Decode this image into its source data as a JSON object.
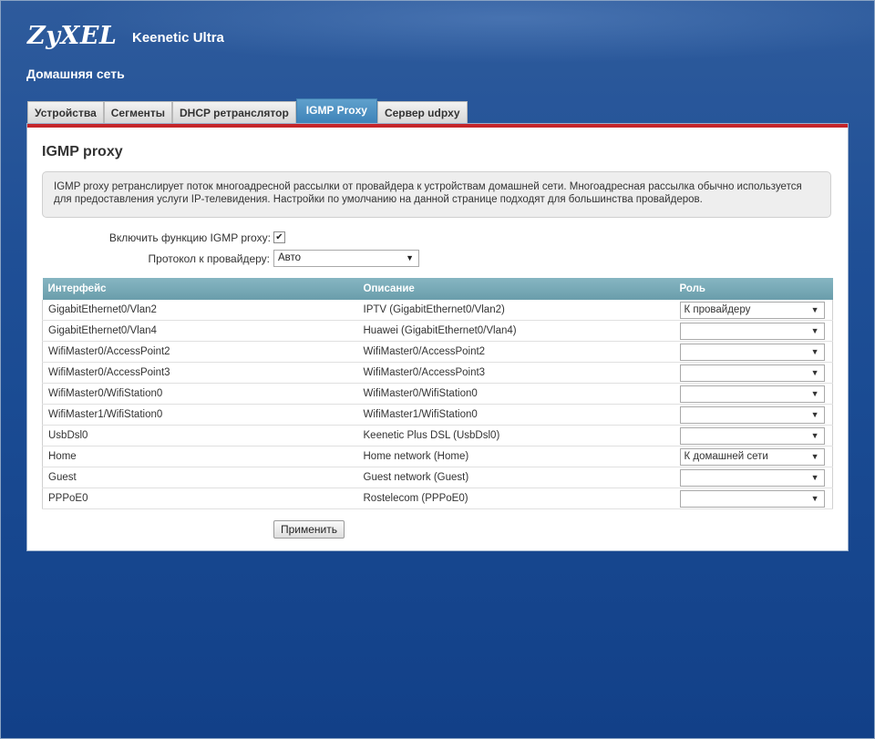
{
  "header": {
    "logo": "ZyXEL",
    "model": "Keenetic Ultra",
    "section": "Домашняя сеть"
  },
  "tabs": [
    {
      "label": "Устройства",
      "active": false
    },
    {
      "label": "Сегменты",
      "active": false
    },
    {
      "label": "DHCP ретранслятор",
      "active": false
    },
    {
      "label": "IGMP Proxy",
      "active": true
    },
    {
      "label": "Сервер udpxy",
      "active": false
    }
  ],
  "panel": {
    "title": "IGMP proxy",
    "info": "IGMP proxy ретранслирует поток многоадресной рассылки от провайдера к устройствам домашней сети. Многоадресная рассылка обычно используется для предоставления услуги IP-телевидения. Настройки по умолчанию на данной странице подходят для большинства провайдеров."
  },
  "form": {
    "enable_label": "Включить функцию IGMP proxy:",
    "enable_checked": true,
    "protocol_label": "Протокол к провайдеру:",
    "protocol_value": "Авто"
  },
  "table": {
    "headers": [
      "Интерфейс",
      "Описание",
      "Роль"
    ],
    "rows": [
      {
        "interface": "GigabitEthernet0/Vlan2",
        "description": "IPTV (GigabitEthernet0/Vlan2)",
        "role": "К провайдеру"
      },
      {
        "interface": "GigabitEthernet0/Vlan4",
        "description": "Huawei (GigabitEthernet0/Vlan4)",
        "role": ""
      },
      {
        "interface": "WifiMaster0/AccessPoint2",
        "description": "WifiMaster0/AccessPoint2",
        "role": ""
      },
      {
        "interface": "WifiMaster0/AccessPoint3",
        "description": "WifiMaster0/AccessPoint3",
        "role": ""
      },
      {
        "interface": "WifiMaster0/WifiStation0",
        "description": "WifiMaster0/WifiStation0",
        "role": ""
      },
      {
        "interface": "WifiMaster1/WifiStation0",
        "description": "WifiMaster1/WifiStation0",
        "role": ""
      },
      {
        "interface": "UsbDsl0",
        "description": "Keenetic Plus DSL (UsbDsl0)",
        "role": ""
      },
      {
        "interface": "Home",
        "description": "Home network (Home)",
        "role": "К домашней сети"
      },
      {
        "interface": "Guest",
        "description": "Guest network (Guest)",
        "role": ""
      },
      {
        "interface": "PPPoE0",
        "description": "Rostelecom (PPPoE0)",
        "role": ""
      }
    ]
  },
  "apply_label": "Применить",
  "icons": {
    "checkmark": "checkmark-icon",
    "dropdown": "dropdown-arrow-icon"
  }
}
